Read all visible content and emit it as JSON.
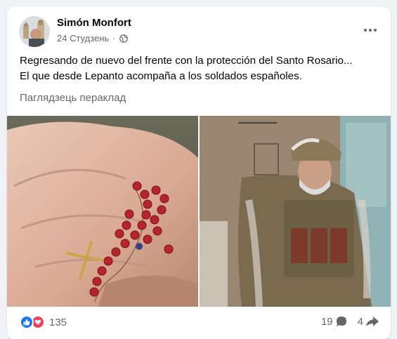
{
  "post": {
    "author": "Simón Monfort",
    "date": "24 Студзень",
    "separator": "·",
    "privacy_icon": "globe-icon",
    "menu_icon": "more-icon",
    "text_line1": "Regresando de nuevo del frente con la protección del Santo Rosario...",
    "text_line2": "El que desde Lepanto acompaña a los soldados españoles.",
    "translate_label": "Паглядзець пераклад"
  },
  "photos": [
    {
      "icon": "rosary-photo",
      "depicts": "hand holding red rosary"
    },
    {
      "icon": "soldier-photo",
      "depicts": "soldier in camouflage gear"
    }
  ],
  "footer": {
    "reaction_icons": [
      "like-icon",
      "love-icon"
    ],
    "reaction_count": "135",
    "comment_count": "19",
    "share_count": "4"
  },
  "colors": {
    "background": "#f0f2f5",
    "card": "#ffffff",
    "secondary_text": "#65676b",
    "like_blue": "#1877f2",
    "love_red": "#f33e58"
  }
}
